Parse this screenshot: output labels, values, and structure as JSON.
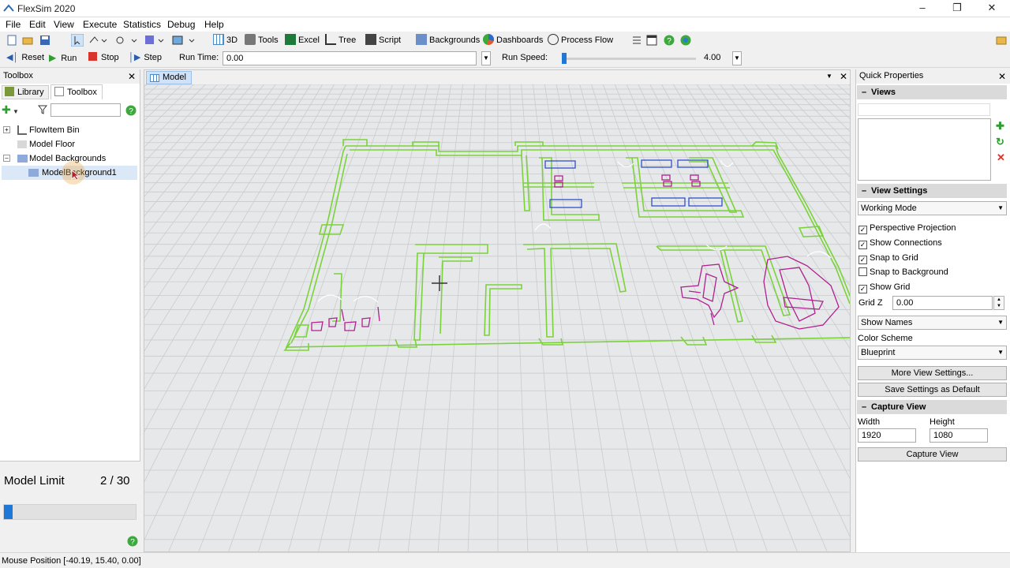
{
  "window": {
    "title": "FlexSim 2020"
  },
  "menu": [
    "File",
    "Edit",
    "View",
    "Execute",
    "Statistics",
    "Debug",
    "Help"
  ],
  "toolbar": {
    "view3d": "3D",
    "tools": "Tools",
    "excel": "Excel",
    "tree": "Tree",
    "script": "Script",
    "backgrounds": "Backgrounds",
    "dashboards": "Dashboards",
    "process_flow": "Process Flow"
  },
  "run_controls": {
    "reset": "Reset",
    "run": "Run",
    "stop": "Stop",
    "step": "Step",
    "run_time_label": "Run Time:",
    "run_time_value": "0.00",
    "run_speed_label": "Run Speed:",
    "run_speed_value": "4.00"
  },
  "left_panel": {
    "title": "Toolbox",
    "tabs": [
      "Library",
      "Toolbox"
    ],
    "tree": [
      {
        "label": "FlowItem Bin"
      },
      {
        "label": "Model Floor"
      },
      {
        "label": "Model Backgrounds"
      },
      {
        "label": "ModelBackground1"
      }
    ],
    "model_limit_label": "Model Limit",
    "model_limit_value": "2 / 30",
    "model_limit_fraction": 0.0667
  },
  "viewport": {
    "tab": "Model"
  },
  "quick_properties": {
    "title": "Quick Properties",
    "views_header": "Views",
    "view_settings_header": "View Settings",
    "mode": "Working Mode",
    "checkboxes": [
      {
        "label": "Perspective Projection",
        "checked": true
      },
      {
        "label": "Show Connections",
        "checked": true
      },
      {
        "label": "Snap to Grid",
        "checked": true
      },
      {
        "label": "Snap to Background",
        "checked": false
      },
      {
        "label": "Show Grid",
        "checked": true
      }
    ],
    "grid_z_label": "Grid Z",
    "grid_z_value": "0.00",
    "show_names": "Show Names",
    "color_scheme_label": "Color Scheme",
    "color_scheme_value": "Blueprint",
    "more_view_settings": "More View Settings...",
    "save_settings": "Save Settings as Default",
    "capture_view_header": "Capture View",
    "width_label": "Width",
    "width_value": "1920",
    "height_label": "Height",
    "height_value": "1080",
    "capture_view_button": "Capture View"
  },
  "status": {
    "mouse_position": "Mouse Position [-40.19, 15.40, 0.00]"
  },
  "colors": {
    "floorplan": "#7ad33a",
    "magenta": "#b0208f",
    "blue": "#3050c8",
    "grid_bg": "#e7e8ea"
  }
}
